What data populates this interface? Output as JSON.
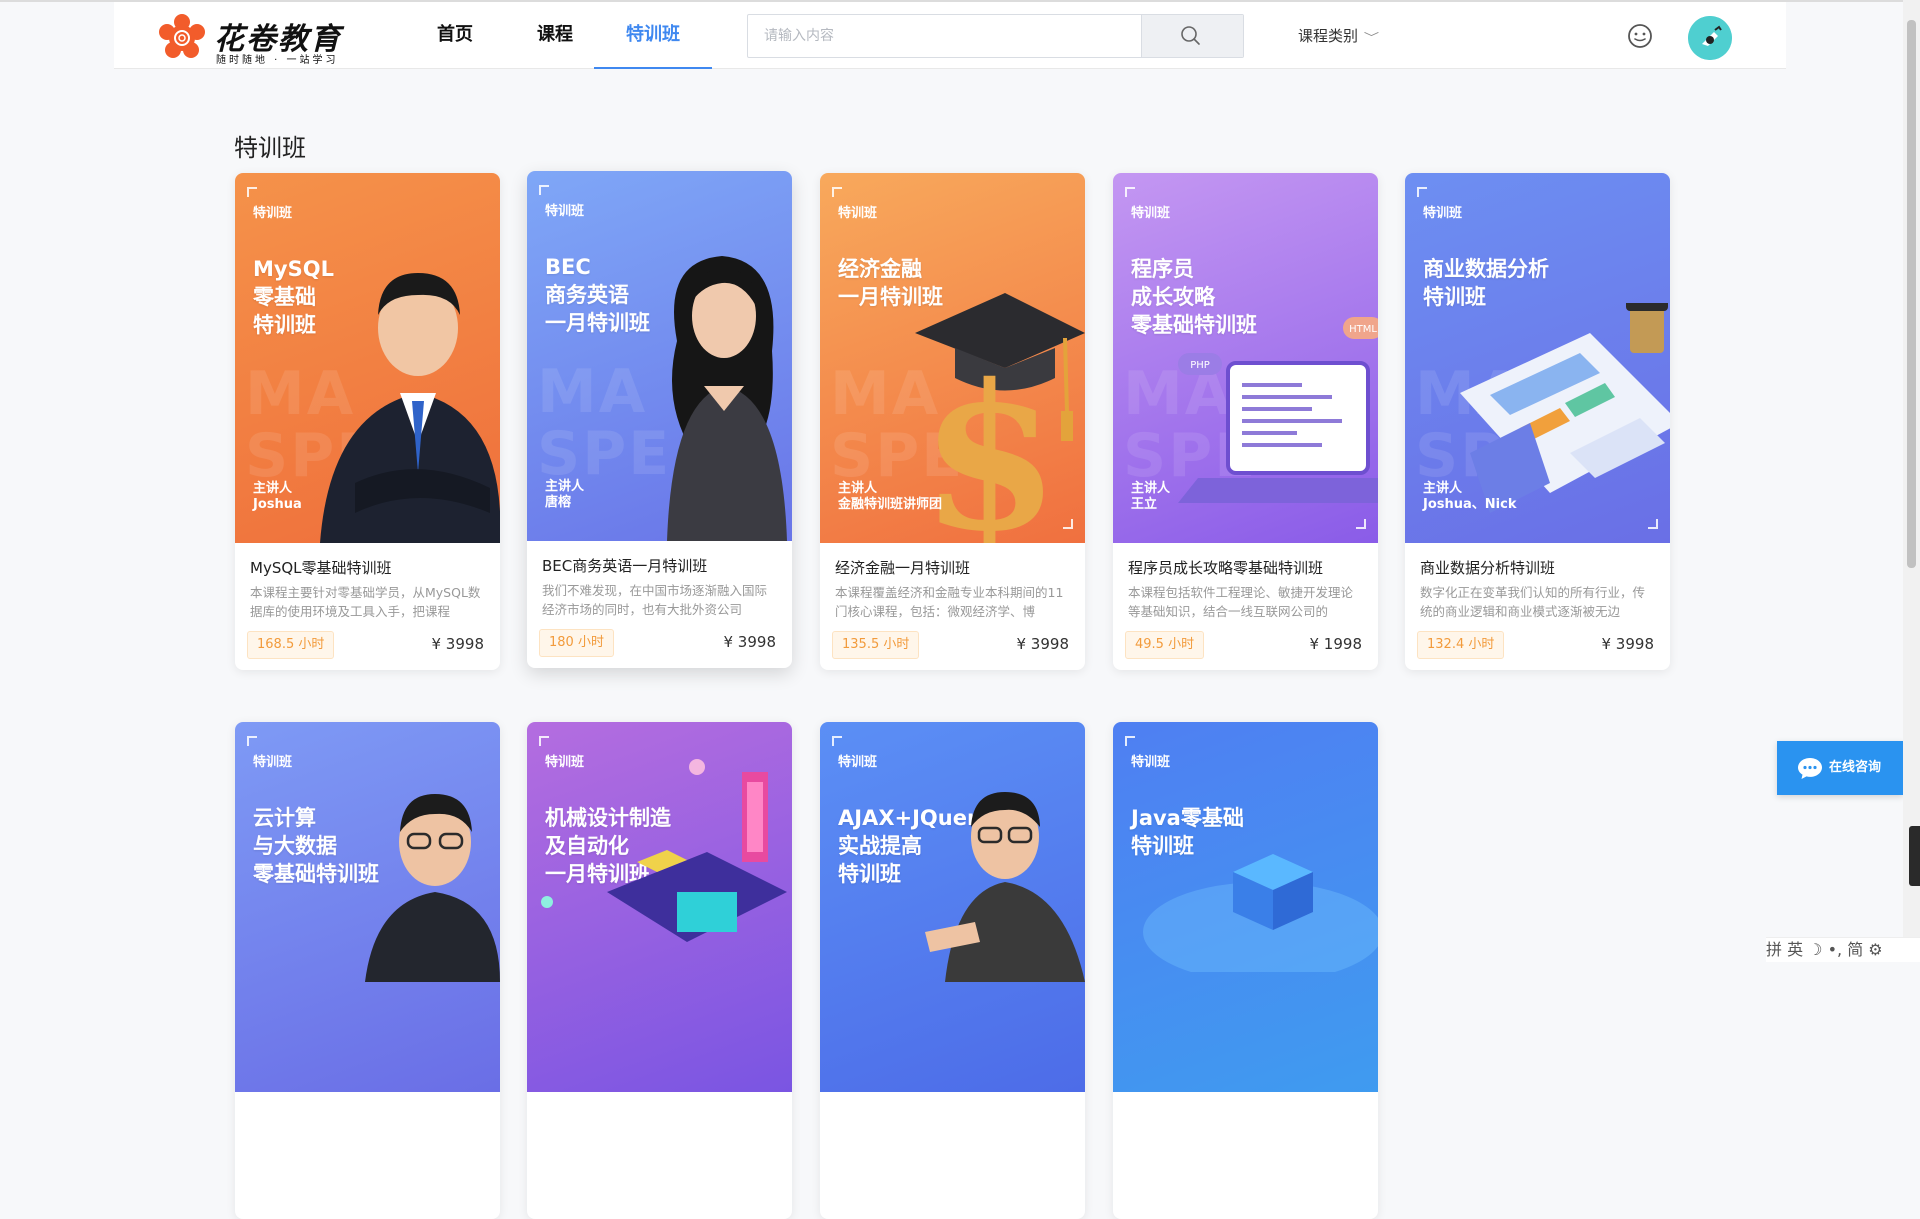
{
  "header": {
    "brand": "花卷教育",
    "slogan": "随时随地 · 一站学习",
    "nav": [
      {
        "label": "首页",
        "active": false
      },
      {
        "label": "课程",
        "active": false
      },
      {
        "label": "特训班",
        "active": true
      }
    ],
    "search_placeholder": "请输入内容",
    "category_label": "课程类别",
    "accent_color": "#3f88f0"
  },
  "section_title": "特训班",
  "courses": [
    {
      "tag": "特训班",
      "cover_title": "MySQL\n零基础\n特训班",
      "speaker": "主讲人\nJoshua",
      "name": "MySQL零基础特训班",
      "desc": "本课程主要针对零基础学员，从MySQL数据库的使用环境及工具入手，把课程",
      "hours": "168.5 小时",
      "price": "¥ 3998",
      "gradient": [
        "#f5924a",
        "#ef6f3b"
      ],
      "illustration": "man-in-suit"
    },
    {
      "tag": "特训班",
      "cover_title": "BEC\n商务英语\n一月特训班",
      "speaker": "主讲人\n唐榕",
      "name": "BEC商务英语一月特训班",
      "desc": "我们不难发现，在中国市场逐渐融入国际经济市场的同时，也有大批外资公司",
      "hours": "180 小时",
      "price": "¥ 3998",
      "gradient": [
        "#7fa7f7",
        "#6975e8"
      ],
      "illustration": "woman-portrait"
    },
    {
      "tag": "特训班",
      "cover_title": "经济金融\n一月特训班",
      "speaker": "主讲人\n金融特训班讲师团",
      "name": "经济金融一月特训班",
      "desc": "本课程覆盖经济和金融专业本科期间的11门核心课程，包括：微观经济学、博",
      "hours": "135.5 小时",
      "price": "¥ 3998",
      "gradient": [
        "#f8a95c",
        "#f0703f"
      ],
      "illustration": "dollar-cap"
    },
    {
      "tag": "特训班",
      "cover_title": "程序员\n成长攻略\n零基础特训班",
      "speaker": "主讲人\n王立",
      "name": "程序员成长攻略零基础特训班",
      "desc": "本课程包括软件工程理论、敏捷开发理论等基础知识，结合一线互联网公司的",
      "hours": "49.5 小时",
      "price": "¥ 1998",
      "gradient": [
        "#c497f2",
        "#8a5ce8"
      ],
      "illustration": "laptop-code",
      "badges": [
        "HTML",
        "PHP"
      ]
    },
    {
      "tag": "特训班",
      "cover_title": "商业数据分析\n特训班",
      "speaker": "主讲人\nJoshua、Nick",
      "name": "商业数据分析特训班",
      "desc": "数字化正在变革我们认知的所有行业，传统的商业逻辑和商业模式逐渐被无边",
      "hours": "132.4 小时",
      "price": "¥ 3998",
      "gradient": [
        "#6d8ff2",
        "#6a6fe6"
      ],
      "illustration": "data-report"
    },
    {
      "tag": "特训班",
      "cover_title": "云计算\n与大数据\n零基础特训班",
      "gradient": [
        "#7e9af5",
        "#6a6ee6"
      ],
      "illustration": "man-glasses"
    },
    {
      "tag": "特训班",
      "cover_title": "机械设计制造\n及自动化\n一月特训班",
      "gradient": [
        "#b46de0",
        "#7a55e2"
      ],
      "illustration": "machine-city"
    },
    {
      "tag": "特训班",
      "cover_title": "AJAX+JQuery\n实战提高\n特训班",
      "gradient": [
        "#5b8ff5",
        "#4d6ce8"
      ],
      "illustration": "man-thumbs-down"
    },
    {
      "tag": "特训班",
      "cover_title": "Java零基础\n特训班",
      "gradient": [
        "#4f7ff2",
        "#3f9bf0"
      ],
      "illustration": "server-stack"
    }
  ],
  "consult_label": "在线咨询",
  "ime_bar": "拼 英 ☽ •, 简 ⚙"
}
